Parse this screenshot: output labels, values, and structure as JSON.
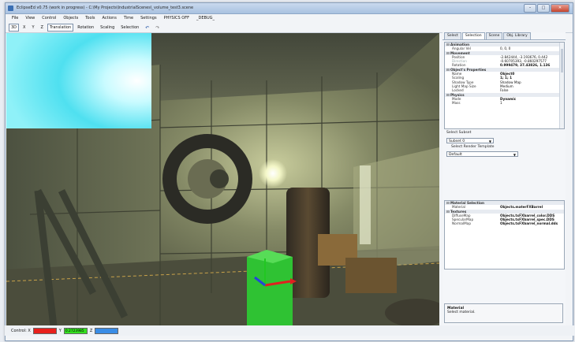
{
  "window": {
    "title": "EclipseEd v0.75 (work in progress) - C:\\My Projects\\IndustrialScenes\\_volume_test3.scene",
    "controls": {
      "minimize": "–",
      "maximize": "□",
      "close": "✕"
    }
  },
  "menu": [
    "File",
    "View",
    "Control",
    "Objects",
    "Tools",
    "Actions",
    "Time",
    "Settings",
    "PHYSICS OFF",
    "_DEBUG_"
  ],
  "toolbar": {
    "items": [
      "3D",
      "X",
      "Y",
      "Z",
      "Translation",
      "Rotation",
      "Scaling",
      "Selection"
    ],
    "undo_icon": "undo-icon",
    "redo_icon": "redo-icon"
  },
  "panel": {
    "tabs": [
      "Select",
      "Selection",
      "Scene",
      "Obj. Library"
    ],
    "active_tab": "Selection",
    "properties": [
      {
        "type": "category",
        "name": "Animation"
      },
      {
        "type": "row",
        "name": "Angular Vel",
        "value": "0, 0, 0"
      },
      {
        "type": "category",
        "name": "Movement"
      },
      {
        "type": "row",
        "name": "Position",
        "value": "-2.842444, -3.193676, 0.442"
      },
      {
        "type": "row",
        "name": "Direction",
        "value": "-0.60705393, -0.860297577",
        "dim": true
      },
      {
        "type": "row",
        "name": "Rotation",
        "value": "0.999479, 37.43826, 1.136",
        "bold": true
      },
      {
        "type": "category",
        "name": "Object's Properties"
      },
      {
        "type": "row",
        "name": "Name",
        "value": "Object0",
        "bold": true
      },
      {
        "type": "row",
        "name": "Scaling",
        "value": "1; 1; 1",
        "bold": true
      },
      {
        "type": "row",
        "name": "Shadow Type",
        "value": "Shadow Map"
      },
      {
        "type": "row",
        "name": "Light Map Size",
        "value": "Medium"
      },
      {
        "type": "row",
        "name": "Locked",
        "value": "False"
      },
      {
        "type": "category",
        "name": "Physics"
      },
      {
        "type": "row",
        "name": "Mode",
        "value": "Dynamic",
        "bold": true
      },
      {
        "type": "row",
        "name": "Mass",
        "value": "1"
      }
    ],
    "select_subset_label": "Select Subset",
    "subset_value": "Subset 0",
    "select_render_template_label": "Select Render Template",
    "render_template_value": "Default",
    "material_props": [
      {
        "type": "category",
        "name": "Material Selection"
      },
      {
        "type": "row",
        "name": "Material",
        "value": "Objects.materFXBarrel",
        "bold": true
      },
      {
        "type": "category",
        "name": "Textures"
      },
      {
        "type": "row",
        "name": "DiffuseMap",
        "value": "Objects.txFXbarrel_color.DDS",
        "bold": true
      },
      {
        "type": "row",
        "name": "SpecularMap",
        "value": "Objects.txFXbarrel_spec.DDS",
        "bold": true
      },
      {
        "type": "row",
        "name": "NormalMap",
        "value": "Objects.txFXbarrel_normal.dds",
        "bold": true
      }
    ],
    "description_title": "Material",
    "description_text": "Select material."
  },
  "statusbar": {
    "control_label": "Control: X",
    "x_value": "",
    "y_label": "Y",
    "y_value": "0.2723985",
    "z_label": "Z",
    "z_value": "",
    "x_color": "#e8201c",
    "y_color": "#34e020",
    "z_color": "#3a8de6"
  },
  "colors": {
    "accent": "#3a6fb3",
    "viewport_wall": "#6c7054",
    "cube_selected": "#2fc233"
  }
}
